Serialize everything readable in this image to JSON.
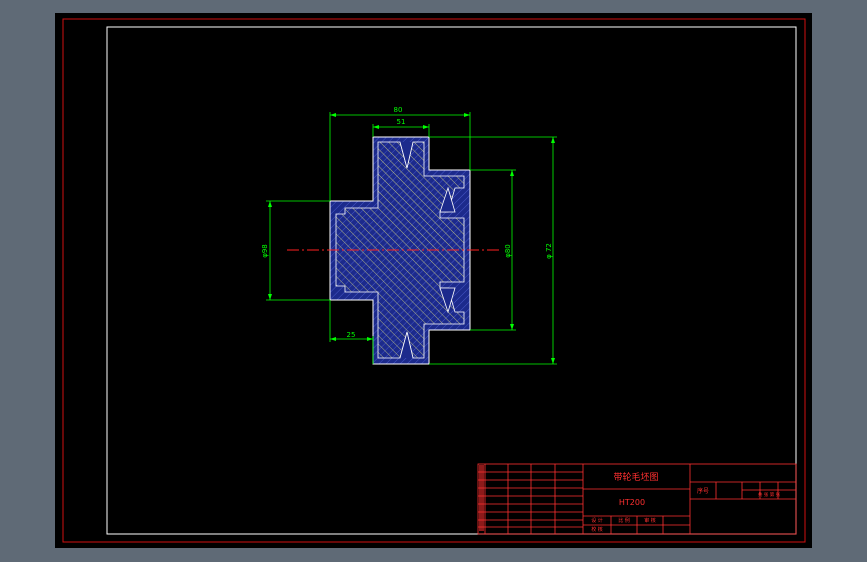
{
  "colors": {
    "background": "#5f6a76",
    "sheet": "#000000",
    "border_red": "#d01010",
    "border_white": "#ffffff",
    "outline": "#ffffff",
    "dim": "#00ff00",
    "hatch_yellow": "#d8d880",
    "hatch_blue": "#1c2a8c",
    "center": "#ff2020",
    "title_text": "#ff3030"
  },
  "drawing": {
    "dims": {
      "top_width": "80",
      "inner_width": "51",
      "bottom_width": "25",
      "left_dia": "φ98",
      "right_dia": "φ80",
      "outer_dia": "φ 72"
    }
  },
  "title_block": {
    "part_name": "带轮毛坯图",
    "material": "HT200",
    "seq_label": "序号",
    "label_c1": "设 计",
    "label_c2": "校 核",
    "label_c3": "审 核",
    "label_scale": "比 例",
    "label_sheet": "共 张 第 张"
  }
}
